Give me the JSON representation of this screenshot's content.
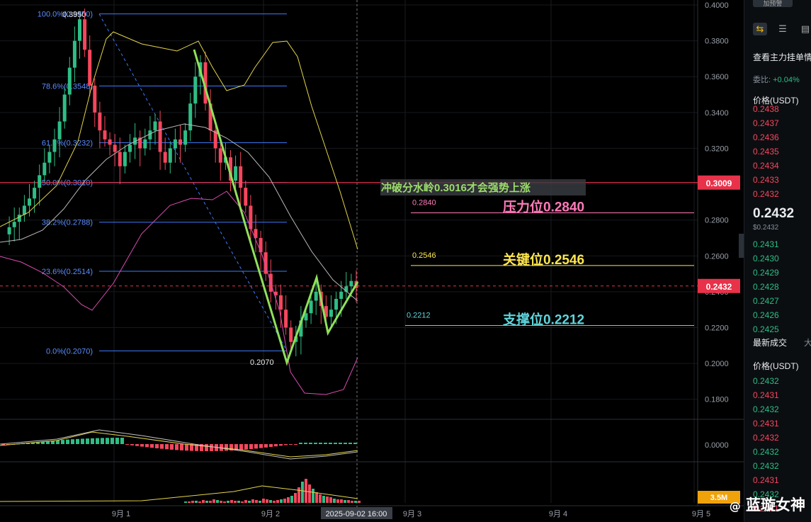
{
  "chart_data": {
    "type": "candlestick",
    "y_axis": {
      "range": [
        0.17,
        0.4
      ],
      "ticks": [
        "0.4000",
        "0.3800",
        "0.3600",
        "0.3400",
        "0.3200",
        "0.3000",
        "0.2800",
        "0.2600",
        "0.2400",
        "0.2200",
        "0.2000",
        "0.1800"
      ]
    },
    "x_axis": {
      "ticks": [
        "9月 1",
        "9月 2",
        "9月 3",
        "9月 4",
        "9月 5"
      ],
      "crosshair_label": "2025-09-02 16:00"
    },
    "fibonacci": [
      {
        "label": "100.0%(0.3950)",
        "value": 0.395
      },
      {
        "label": "78.6%(0.3548)",
        "value": 0.3548
      },
      {
        "label": "61.8%(0.3232)",
        "value": 0.3232
      },
      {
        "label": "50.0%(0.3010)",
        "value": 0.301
      },
      {
        "label": "38.2%(0.2788)",
        "value": 0.2788
      },
      {
        "label": "23.6%(0.2514)",
        "value": 0.2514
      },
      {
        "label": "0.0%(0.2070)",
        "value": 0.207
      }
    ],
    "fib_high_label": "0.3950",
    "fib_low_label": "0.2070",
    "red_line": {
      "value": 0.3009,
      "tag": "0.3009"
    },
    "current_price": {
      "value": 0.2432,
      "tag": "0.2432"
    },
    "annotations": [
      {
        "text": "冲破分水岭0.3016才会强势上涨",
        "color": "#9bdc6a"
      },
      {
        "text": "压力位0.2840",
        "small": "0.2840",
        "value": 0.284,
        "color": "#ff7ab8"
      },
      {
        "text": "关键位0.2546",
        "small": "0.2546",
        "value": 0.2546,
        "color": "#ffe650"
      },
      {
        "text": "支撑位0.2212",
        "small": "0.2212",
        "value": 0.2212,
        "color": "#5fd5dc"
      }
    ],
    "volume_tag": "3.5M",
    "macd_tick": "0.0000"
  },
  "side": {
    "top_tab": "加预警",
    "title": "查看主力挂单情",
    "ratio_label": "委比:",
    "ratio_value": "+0.04%",
    "price_header": "价格(USDT)",
    "asks": [
      "0.2438",
      "0.2437",
      "0.2436",
      "0.2435",
      "0.2434",
      "0.2433",
      "0.2432"
    ],
    "mid_price": "0.2432",
    "mid_sub": "$0.2432",
    "bids": [
      "0.2431",
      "0.2430",
      "0.2429",
      "0.2428",
      "0.2427",
      "0.2426",
      "0.2425"
    ],
    "trades_title": "最新成交",
    "trades_tab2": "大",
    "trades_header": "价格(USDT)",
    "trades": [
      {
        "p": "0.2432",
        "d": "up"
      },
      {
        "p": "0.2431",
        "d": "dn"
      },
      {
        "p": "0.2432",
        "d": "up"
      },
      {
        "p": "0.2431",
        "d": "dn"
      },
      {
        "p": "0.2432",
        "d": "dn"
      },
      {
        "p": "0.2432",
        "d": "up"
      },
      {
        "p": "0.2432",
        "d": "up"
      },
      {
        "p": "0.2431",
        "d": "dn"
      },
      {
        "p": "0.2432",
        "d": "up"
      },
      {
        "p": "0.2431",
        "d": "dn"
      }
    ]
  },
  "watermark": "蓝璇女神",
  "watermark_icon": "at-icon"
}
